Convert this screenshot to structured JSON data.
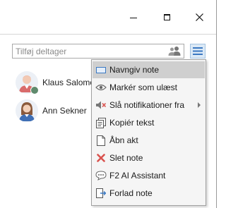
{
  "search": {
    "placeholder": "Tilføj deltager"
  },
  "participants": [
    {
      "name": "Klaus Salomo"
    },
    {
      "name": "Ann Sekner"
    }
  ],
  "menu": {
    "items": [
      {
        "label": "Navngiv note",
        "icon": "rename-icon"
      },
      {
        "label": "Markér som ulæst",
        "icon": "eye-icon"
      },
      {
        "label": "Slå notifikationer fra",
        "icon": "mute-icon"
      },
      {
        "label": "Kopiér tekst",
        "icon": "copy-icon"
      },
      {
        "label": "Åbn akt",
        "icon": "document-icon"
      },
      {
        "label": "Slet note",
        "icon": "delete-icon"
      },
      {
        "label": "F2 AI Assistant",
        "icon": "ai-assistant-icon"
      },
      {
        "label": "Forlad note",
        "icon": "leave-icon"
      }
    ]
  },
  "colors": {
    "active_item": "#cfcfcf",
    "menu_button_bg": "#dbe9f6",
    "status_online": "#5f8a6d",
    "delete_red": "#d9534f",
    "accent_blue": "#3a78c2"
  }
}
